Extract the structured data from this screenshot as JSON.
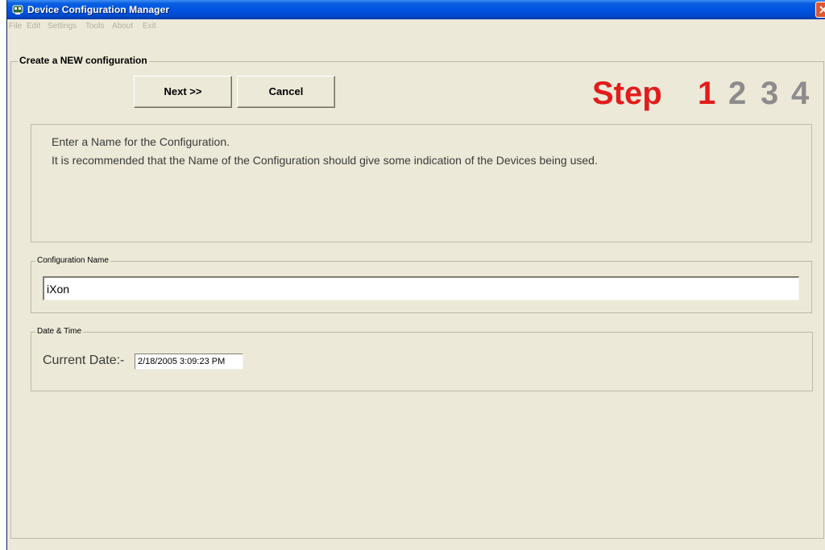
{
  "window": {
    "title": "Device Configuration Manager"
  },
  "menu": [
    "File",
    "Edit",
    "Settings",
    "Tools",
    "About",
    "Exit"
  ],
  "main_group": {
    "legend": "Create a NEW configuration"
  },
  "buttons": {
    "next": "Next >>",
    "cancel": "Cancel"
  },
  "steps": {
    "step_word": "Step",
    "current": "1",
    "others": [
      "2",
      "3",
      "4"
    ]
  },
  "instructions": [
    "Enter a Name for the Configuration.",
    "It is recommended that the Name of the Configuration should give some indication of the Devices being used."
  ],
  "config_name": {
    "legend": "Configuration Name",
    "value": "iXon"
  },
  "date_time": {
    "legend": "Date & Time",
    "label": "Current Date:-",
    "value": "2/18/2005 3:09:23 PM"
  }
}
